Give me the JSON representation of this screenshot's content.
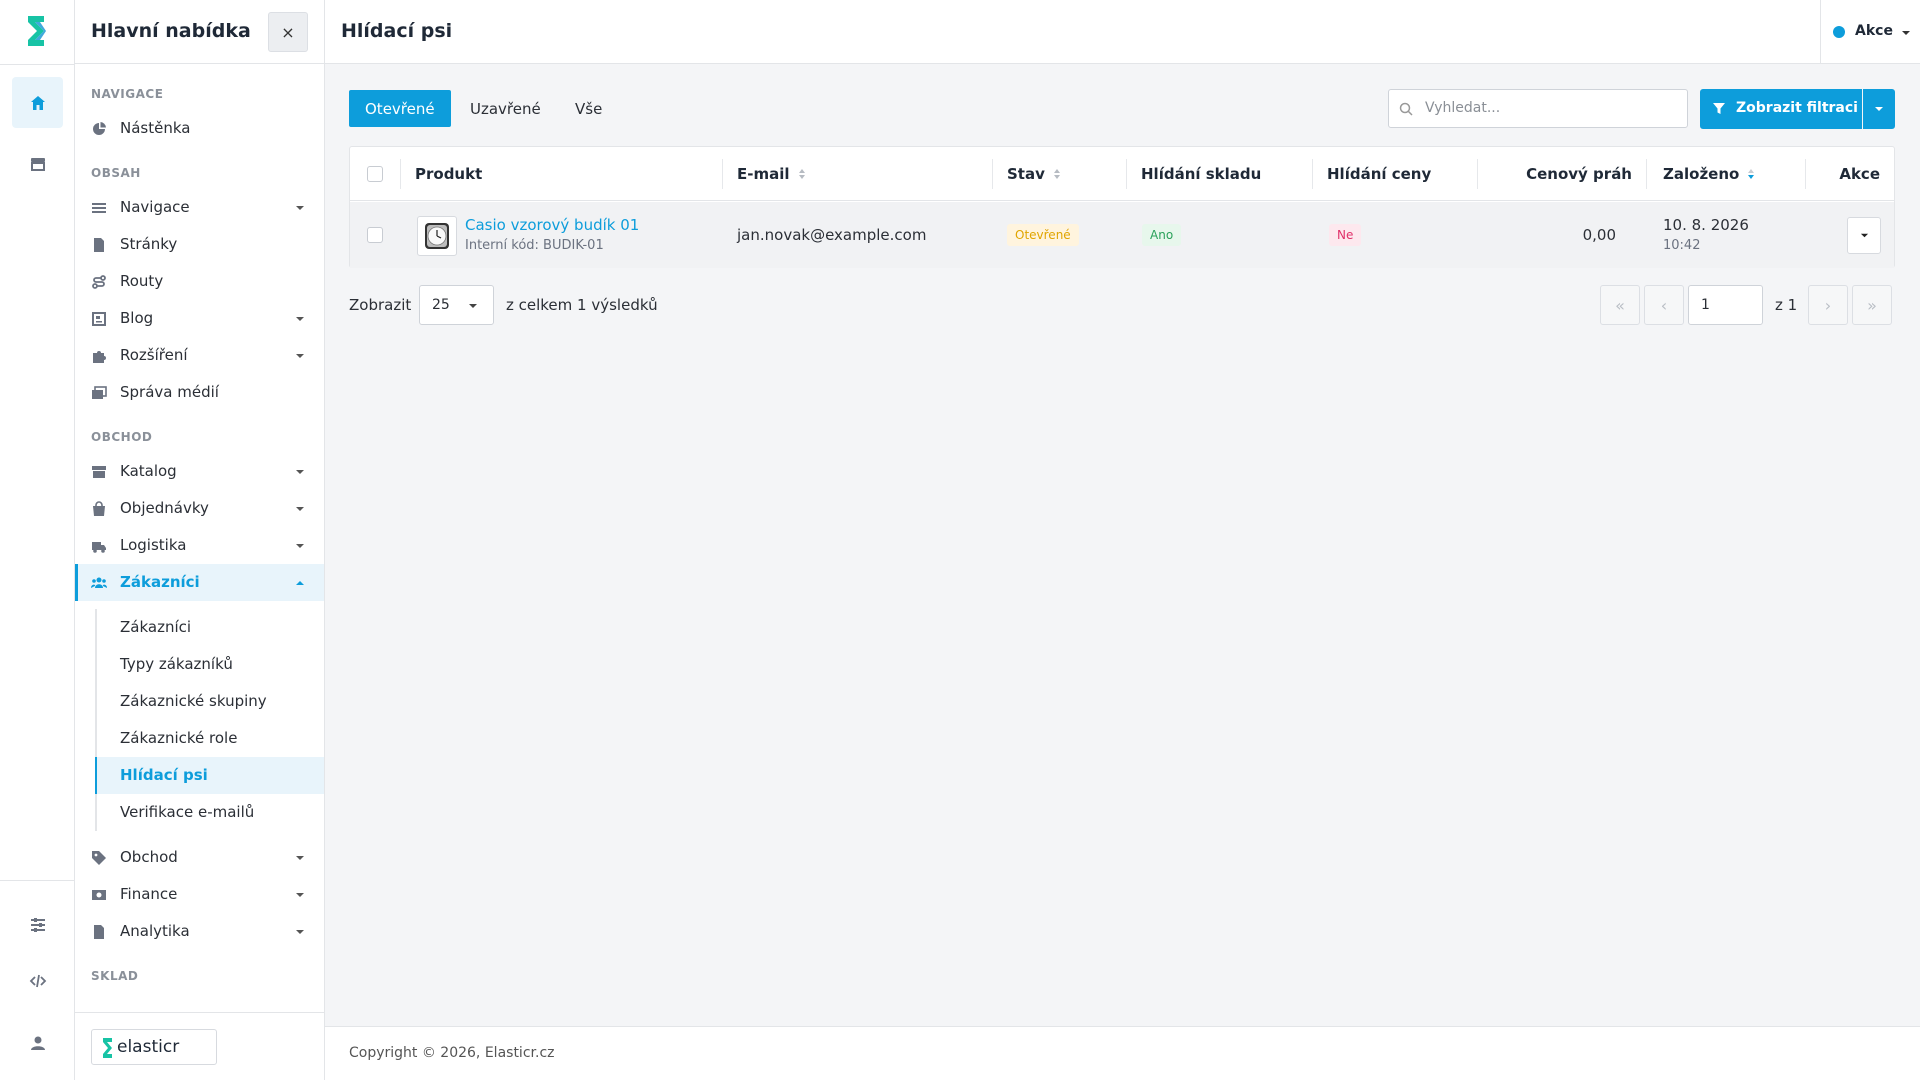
{
  "colors": {
    "accent": "#0d9ddb",
    "open_badge": "#e0a500",
    "yes_badge": "#2aa15a",
    "no_badge": "#e0306a"
  },
  "rail": {
    "items": [
      {
        "icon": "home-icon",
        "active": true
      },
      {
        "icon": "store-icon",
        "active": false
      },
      {
        "icon": "sliders-icon",
        "active": false
      },
      {
        "icon": "code-icon",
        "active": false
      },
      {
        "icon": "user-icon",
        "active": false
      }
    ]
  },
  "sidebar": {
    "title": "Hlavní nabídka",
    "close_label": "×",
    "sections": {
      "navigace": "NAVIGACE",
      "obsah": "OBSAH",
      "obchod": "OBCHOD",
      "sklad": "SKLAD"
    },
    "items": {
      "nastenka": "Nástěnka",
      "navigace": "Navigace",
      "stranky": "Stránky",
      "routy": "Routy",
      "blog": "Blog",
      "rozsireni": "Rozšíření",
      "sprava_medii": "Správa médií",
      "katalog": "Katalog",
      "objednavky": "Objednávky",
      "logistika": "Logistika",
      "zakaznici": "Zákazníci",
      "obchod": "Obchod",
      "finance": "Finance",
      "analytika": "Analytika"
    },
    "subitems": {
      "zakaznici": "Zákazníci",
      "typy": "Typy zákazníků",
      "skupiny": "Zákaznické skupiny",
      "role": "Zákaznické role",
      "hlidaci_psi": "Hlídací psi",
      "verifikace": "Verifikace e-mailů"
    },
    "brand": "elasticr"
  },
  "header": {
    "title": "Hlídací psi",
    "actions_label": "Akce"
  },
  "tabs": {
    "open": "Otevřené",
    "closed": "Uzavřené",
    "all": "Vše"
  },
  "search": {
    "placeholder": "Vyhledat..."
  },
  "filter": {
    "label": "Zobrazit filtraci"
  },
  "table": {
    "columns": {
      "product": "Produkt",
      "email": "E-mail",
      "status": "Stav",
      "stock_watch": "Hlídání skladu",
      "price_watch": "Hlídání ceny",
      "price_threshold": "Cenový práh",
      "created": "Založeno",
      "actions": "Akce"
    },
    "rows": [
      {
        "product_name": "Casio vzorový budík 01",
        "product_code": "Interní kód: BUDIK-01",
        "email": "jan.novak@example.com",
        "status": "Otevřené",
        "stock_watch": "Ano",
        "price_watch": "Ne",
        "price_threshold": "0,00",
        "created_date": "10. 8. 2026",
        "created_time": "10:42"
      }
    ]
  },
  "pager": {
    "show_label": "Zobrazit",
    "per_page": "25",
    "total_label": "z celkem 1 výsledků",
    "page": "1",
    "of_label": "z 1",
    "first": "«",
    "prev": "‹",
    "next": "›",
    "last": "»"
  },
  "footer": {
    "copyright": "Copyright © 2026, Elasticr.cz"
  }
}
